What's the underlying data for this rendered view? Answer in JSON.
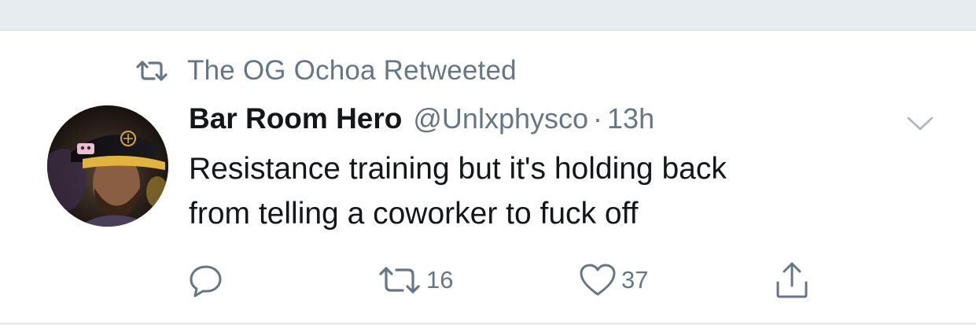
{
  "retweet_context": {
    "icon": "retweet-icon",
    "text": "The OG Ochoa Retweeted"
  },
  "tweet": {
    "avatar": "profile-photo-avatar",
    "display_name": "Bar Room Hero",
    "handle": "@Unlxphysco",
    "separator": "·",
    "timestamp": "13h",
    "text": "Resistance training but it's holding back\nfrom telling a coworker to fuck off",
    "menu_icon": "chevron-down-icon"
  },
  "actions": {
    "reply": {
      "icon": "reply-icon",
      "count": ""
    },
    "retweet": {
      "icon": "retweet-icon",
      "count": "16"
    },
    "like": {
      "icon": "heart-icon",
      "count": "37"
    },
    "share": {
      "icon": "share-icon",
      "count": ""
    }
  },
  "colors": {
    "text_primary": "#14171a",
    "text_secondary": "#657786",
    "divider": "#e6ecf0"
  }
}
